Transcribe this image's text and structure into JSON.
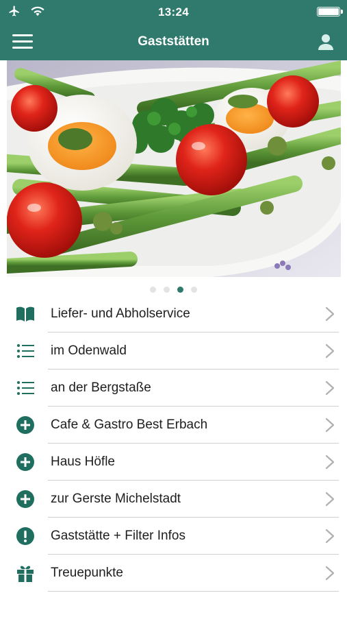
{
  "status_bar": {
    "time": "13:24"
  },
  "nav": {
    "title": "Gaststätten"
  },
  "carousel": {
    "page_count": 4,
    "active_index": 2
  },
  "menu": [
    {
      "label": "Liefer- und Abholservice",
      "icon": "book-icon"
    },
    {
      "label": "im Odenwald",
      "icon": "list-icon"
    },
    {
      "label": "an der Bergstaße",
      "icon": "list-icon"
    },
    {
      "label": "Cafe & Gastro Best Erbach",
      "icon": "plus-circle-icon"
    },
    {
      "label": "Haus Höfle",
      "icon": "plus-circle-icon"
    },
    {
      "label": "zur Gerste Michelstadt",
      "icon": "plus-circle-icon"
    },
    {
      "label": "Gaststätte + Filter Infos",
      "icon": "exclamation-circle-icon"
    },
    {
      "label": "Treuepunkte",
      "icon": "gift-icon"
    }
  ],
  "colors": {
    "primary": "#2f7a6c",
    "icon": "#1f6e60",
    "separator": "#cfcfcf",
    "chevron": "#b0b0b0"
  }
}
